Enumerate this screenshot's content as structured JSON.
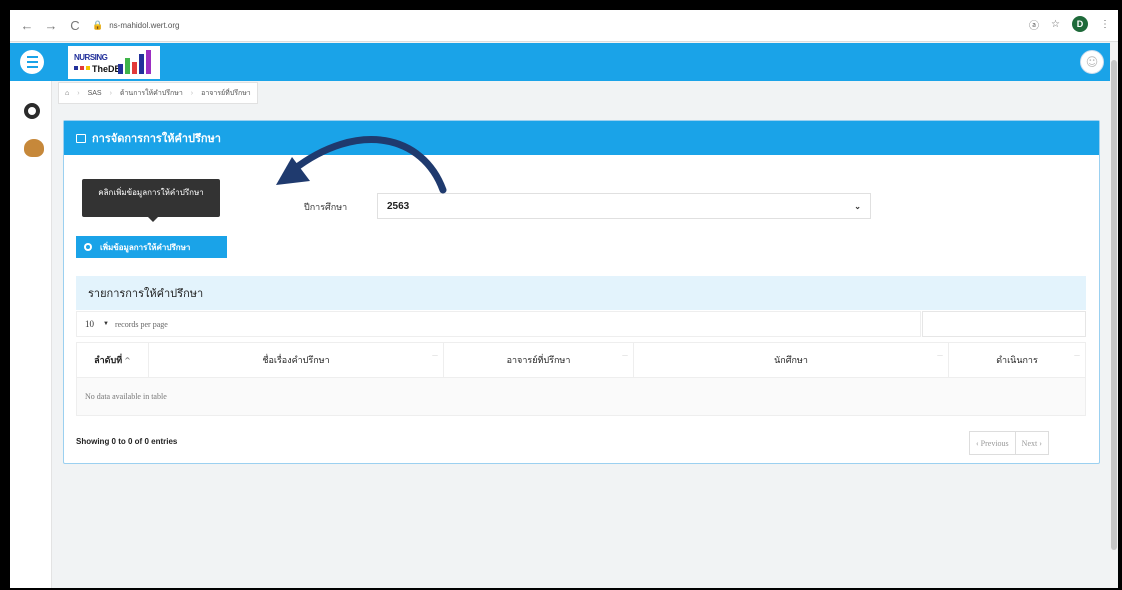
{
  "browser": {
    "url": "ns-mahidol.wert.org",
    "nav_back": "←",
    "nav_forward": "→",
    "nav_reload": "C",
    "profile_letter": "D",
    "star_icon": "☆",
    "translate_icon": "ⓐ",
    "menu_icon": "⋮"
  },
  "logo": {
    "line1": "NURSING",
    "line2": "TheDB"
  },
  "breadcrumb": {
    "items": [
      "SAS",
      "ด้านการให้คำปรึกษา",
      "อาจารย์ที่ปรึกษา"
    ]
  },
  "card": {
    "title": "การจัดการการให้คำปรึกษา",
    "tooltip": "คลิกเพิ่มข้อมูลการให้คำปรึกษา",
    "add_button": "เพิ่มข้อมูลการให้คำปรึกษา",
    "year_label": "ปีการศึกษา",
    "year_value": "2563",
    "list_title": "รายการการให้คำปรึกษา",
    "page_length": "10",
    "page_length_suffix": "records per page",
    "columns": [
      "ลำดับที่",
      "ชื่อเรื่องคำปรึกษา",
      "อาจารย์ที่ปรึกษา",
      "นักศึกษา",
      "ดำเนินการ"
    ],
    "empty_text": "No data available in table",
    "showing": "Showing 0 to 0 of 0 entries",
    "previous": "‹ Previous",
    "next": "Next ›"
  },
  "colors": {
    "primary": "#1aa3e8",
    "list_header_bg": "#e3f3fc",
    "annotation_arrow": "#1f3a6e"
  }
}
